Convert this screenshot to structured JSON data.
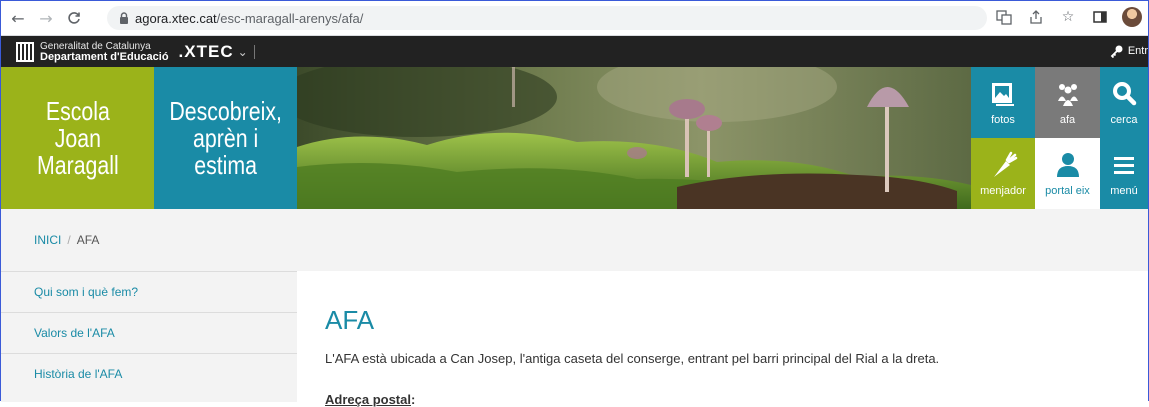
{
  "browser": {
    "url_host": "agora.xtec.cat",
    "url_path": "/esc-maragall-arenys/afa/"
  },
  "topbar": {
    "gencat_line1": "Generalitat de Catalunya",
    "gencat_line2": "Departament d'Educació",
    "xtec": ".XTEC",
    "enter_label": "Entr"
  },
  "hero": {
    "school_name": [
      "Escola",
      "Joan",
      "Maragall"
    ],
    "motto": [
      "Descobreix,",
      "aprèn i",
      "estima"
    ],
    "tiles": {
      "fotos": "fotos",
      "afa": "afa",
      "cerca": "cerca",
      "menjador": "menjador",
      "portal": "portal eix",
      "menu": "menú"
    },
    "colors": {
      "green": "#9bb31a",
      "teal": "#1a8ba6",
      "grey": "#7a7a7a"
    }
  },
  "breadcrumb": {
    "home": "INICI",
    "separator": "/",
    "current": "AFA"
  },
  "sidebar": {
    "items": [
      {
        "label": "Qui som i què fem?"
      },
      {
        "label": "Valors de l'AFA"
      },
      {
        "label": "Història de l'AFA"
      }
    ]
  },
  "main": {
    "title": "AFA",
    "intro": "L'AFA està ubicada a Can Josep, l'antiga caseta del conserge, entrant pel barri principal del Rial a la dreta.",
    "address_heading": "Adreça postal"
  }
}
